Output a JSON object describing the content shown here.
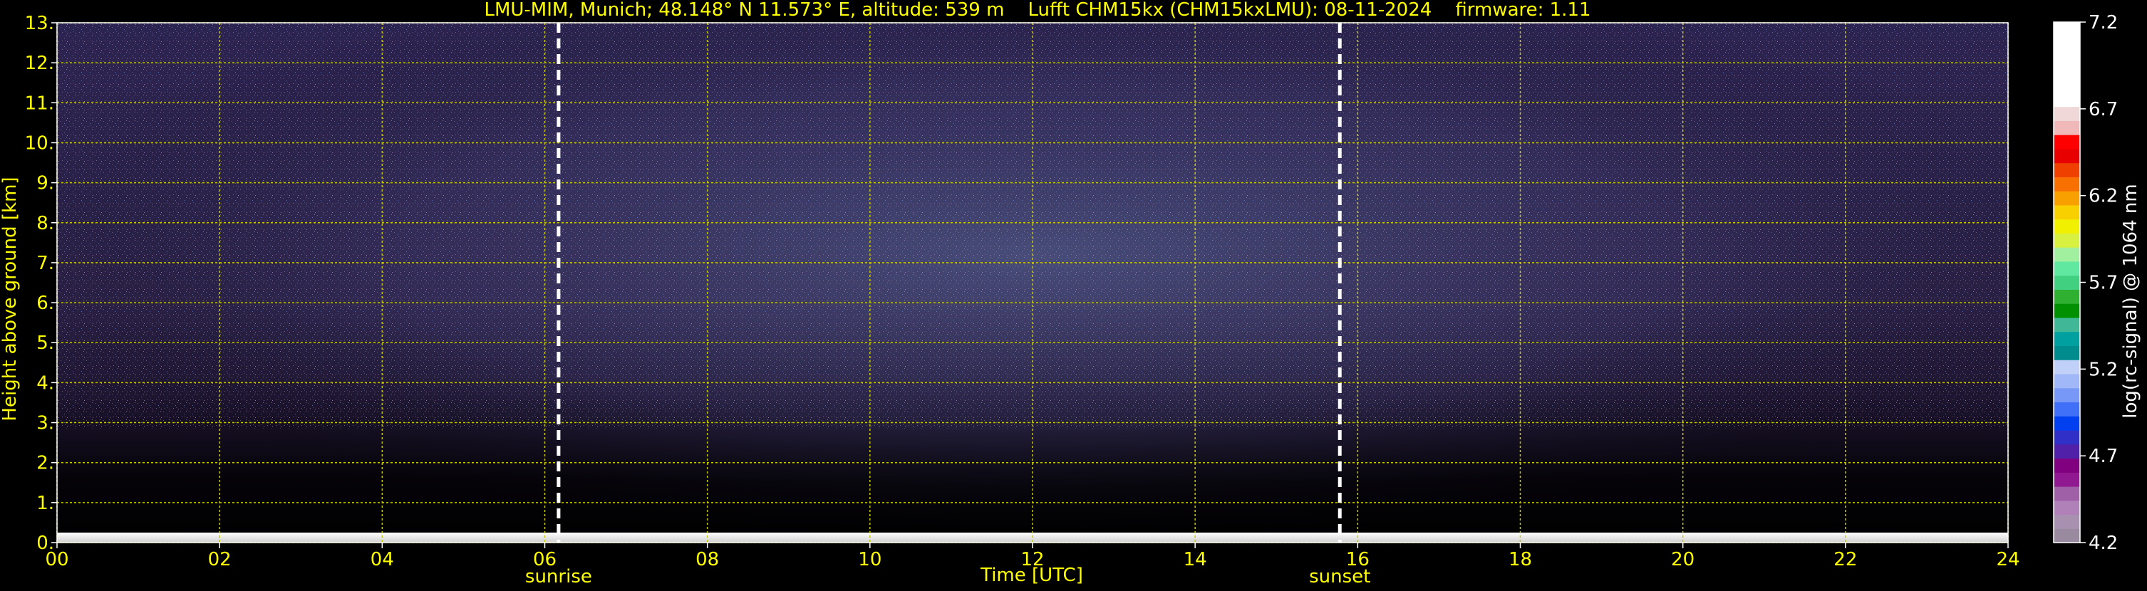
{
  "chart_data": {
    "type": "heatmap",
    "title": "LMU-MIM, Munich; 48.148° N 11.573° E, altitude: 539 m    Lufft CHM15kx (CHM15kxLMU): 08-11-2024    firmware: 1.11",
    "xlabel": "Time [UTC]",
    "ylabel": "Height above ground [km]",
    "colorbar_label": "log(rc-signal) @ 1064 nm",
    "xlim": [
      0,
      24
    ],
    "ylim": [
      0,
      13
    ],
    "x_ticks": [
      "00",
      "02",
      "04",
      "06",
      "08",
      "10",
      "12",
      "14",
      "16",
      "18",
      "20",
      "22",
      "24"
    ],
    "y_ticks": [
      "0.",
      "1.",
      "2.",
      "3.",
      "4.",
      "5.",
      "6.",
      "7.",
      "8.",
      "9.",
      "10.",
      "11.",
      "12.",
      "13."
    ],
    "colorbar_range": [
      4.2,
      7.2
    ],
    "colorbar_ticks": [
      "4.2",
      "4.7",
      "5.2",
      "5.7",
      "6.2",
      "6.7",
      "7.2"
    ],
    "colorbar_colors": [
      "#9a8aa0",
      "#a890b0",
      "#b080b8",
      "#a060a8",
      "#901890",
      "#800080",
      "#5020a8",
      "#3030c8",
      "#0040f0",
      "#4070f8",
      "#7898f8",
      "#a0b8f8",
      "#c0d0f8",
      "#008c8c",
      "#00a0a0",
      "#40b898",
      "#009000",
      "#30b030",
      "#40d080",
      "#60e8a0",
      "#a0f0a0",
      "#d8f040",
      "#f0f000",
      "#f8d000",
      "#f8a000",
      "#f87000",
      "#f04000",
      "#e80000",
      "#ff0000",
      "#f0b8b8",
      "#f0d8d8",
      "#ffffff",
      "#ffffff",
      "#ffffff",
      "#ffffff",
      "#ffffff",
      "#ffffff"
    ],
    "grid": true,
    "grid_color": "#c8c800",
    "events": [
      {
        "label": "sunrise",
        "time": 6.17
      },
      {
        "label": "sunset",
        "time": 15.78
      }
    ],
    "text_color": "#ffff00",
    "background_color": "#000000"
  }
}
